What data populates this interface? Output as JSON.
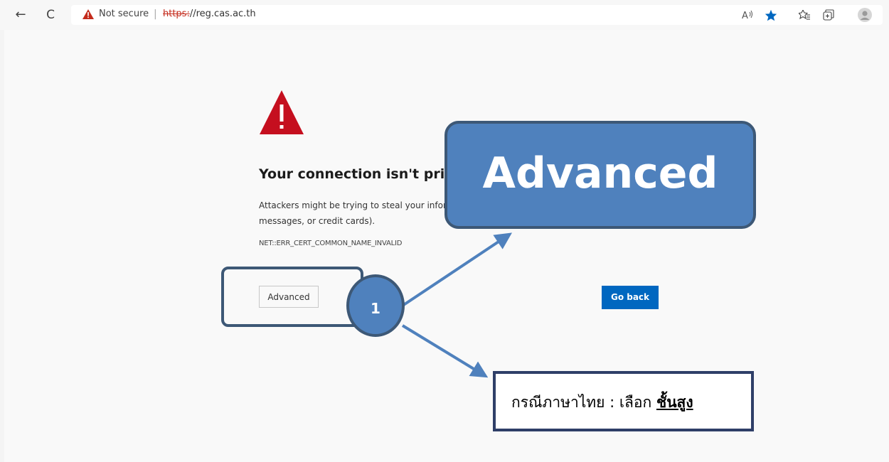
{
  "browser": {
    "nav_back": "←",
    "nav_refresh": "C",
    "security_label": "Not secure",
    "separator": "|",
    "url_scheme": "https:",
    "url_rest": "//reg.cas.ac.th",
    "icons": [
      "back-arrow-icon",
      "refresh-icon",
      "warning-triangle-icon",
      "read-aloud-icon",
      "favorite-star-icon",
      "favorites-list-icon",
      "collections-icon",
      "profile-avatar-icon"
    ],
    "accent_color": "#0067c0",
    "warning_color": "#c42b1c"
  },
  "error_page": {
    "title": "Your connection isn't pri",
    "description_line1": "Attackers might be trying to steal your inform",
    "description_line2": "messages, or credit cards).",
    "error_code": "NET::ERR_CERT_COMMON_NAME_INVALID",
    "advanced_button": "Advanced",
    "go_back_button": "Go back"
  },
  "annotations": {
    "callout_text": "Advanced",
    "step_number": "1",
    "thai_prefix": "กรณีภาษาไทย : เลือก ",
    "thai_emphasis": "ชั้นสูง",
    "callout_color": "#4f81bd",
    "border_color": "#3d5876"
  }
}
